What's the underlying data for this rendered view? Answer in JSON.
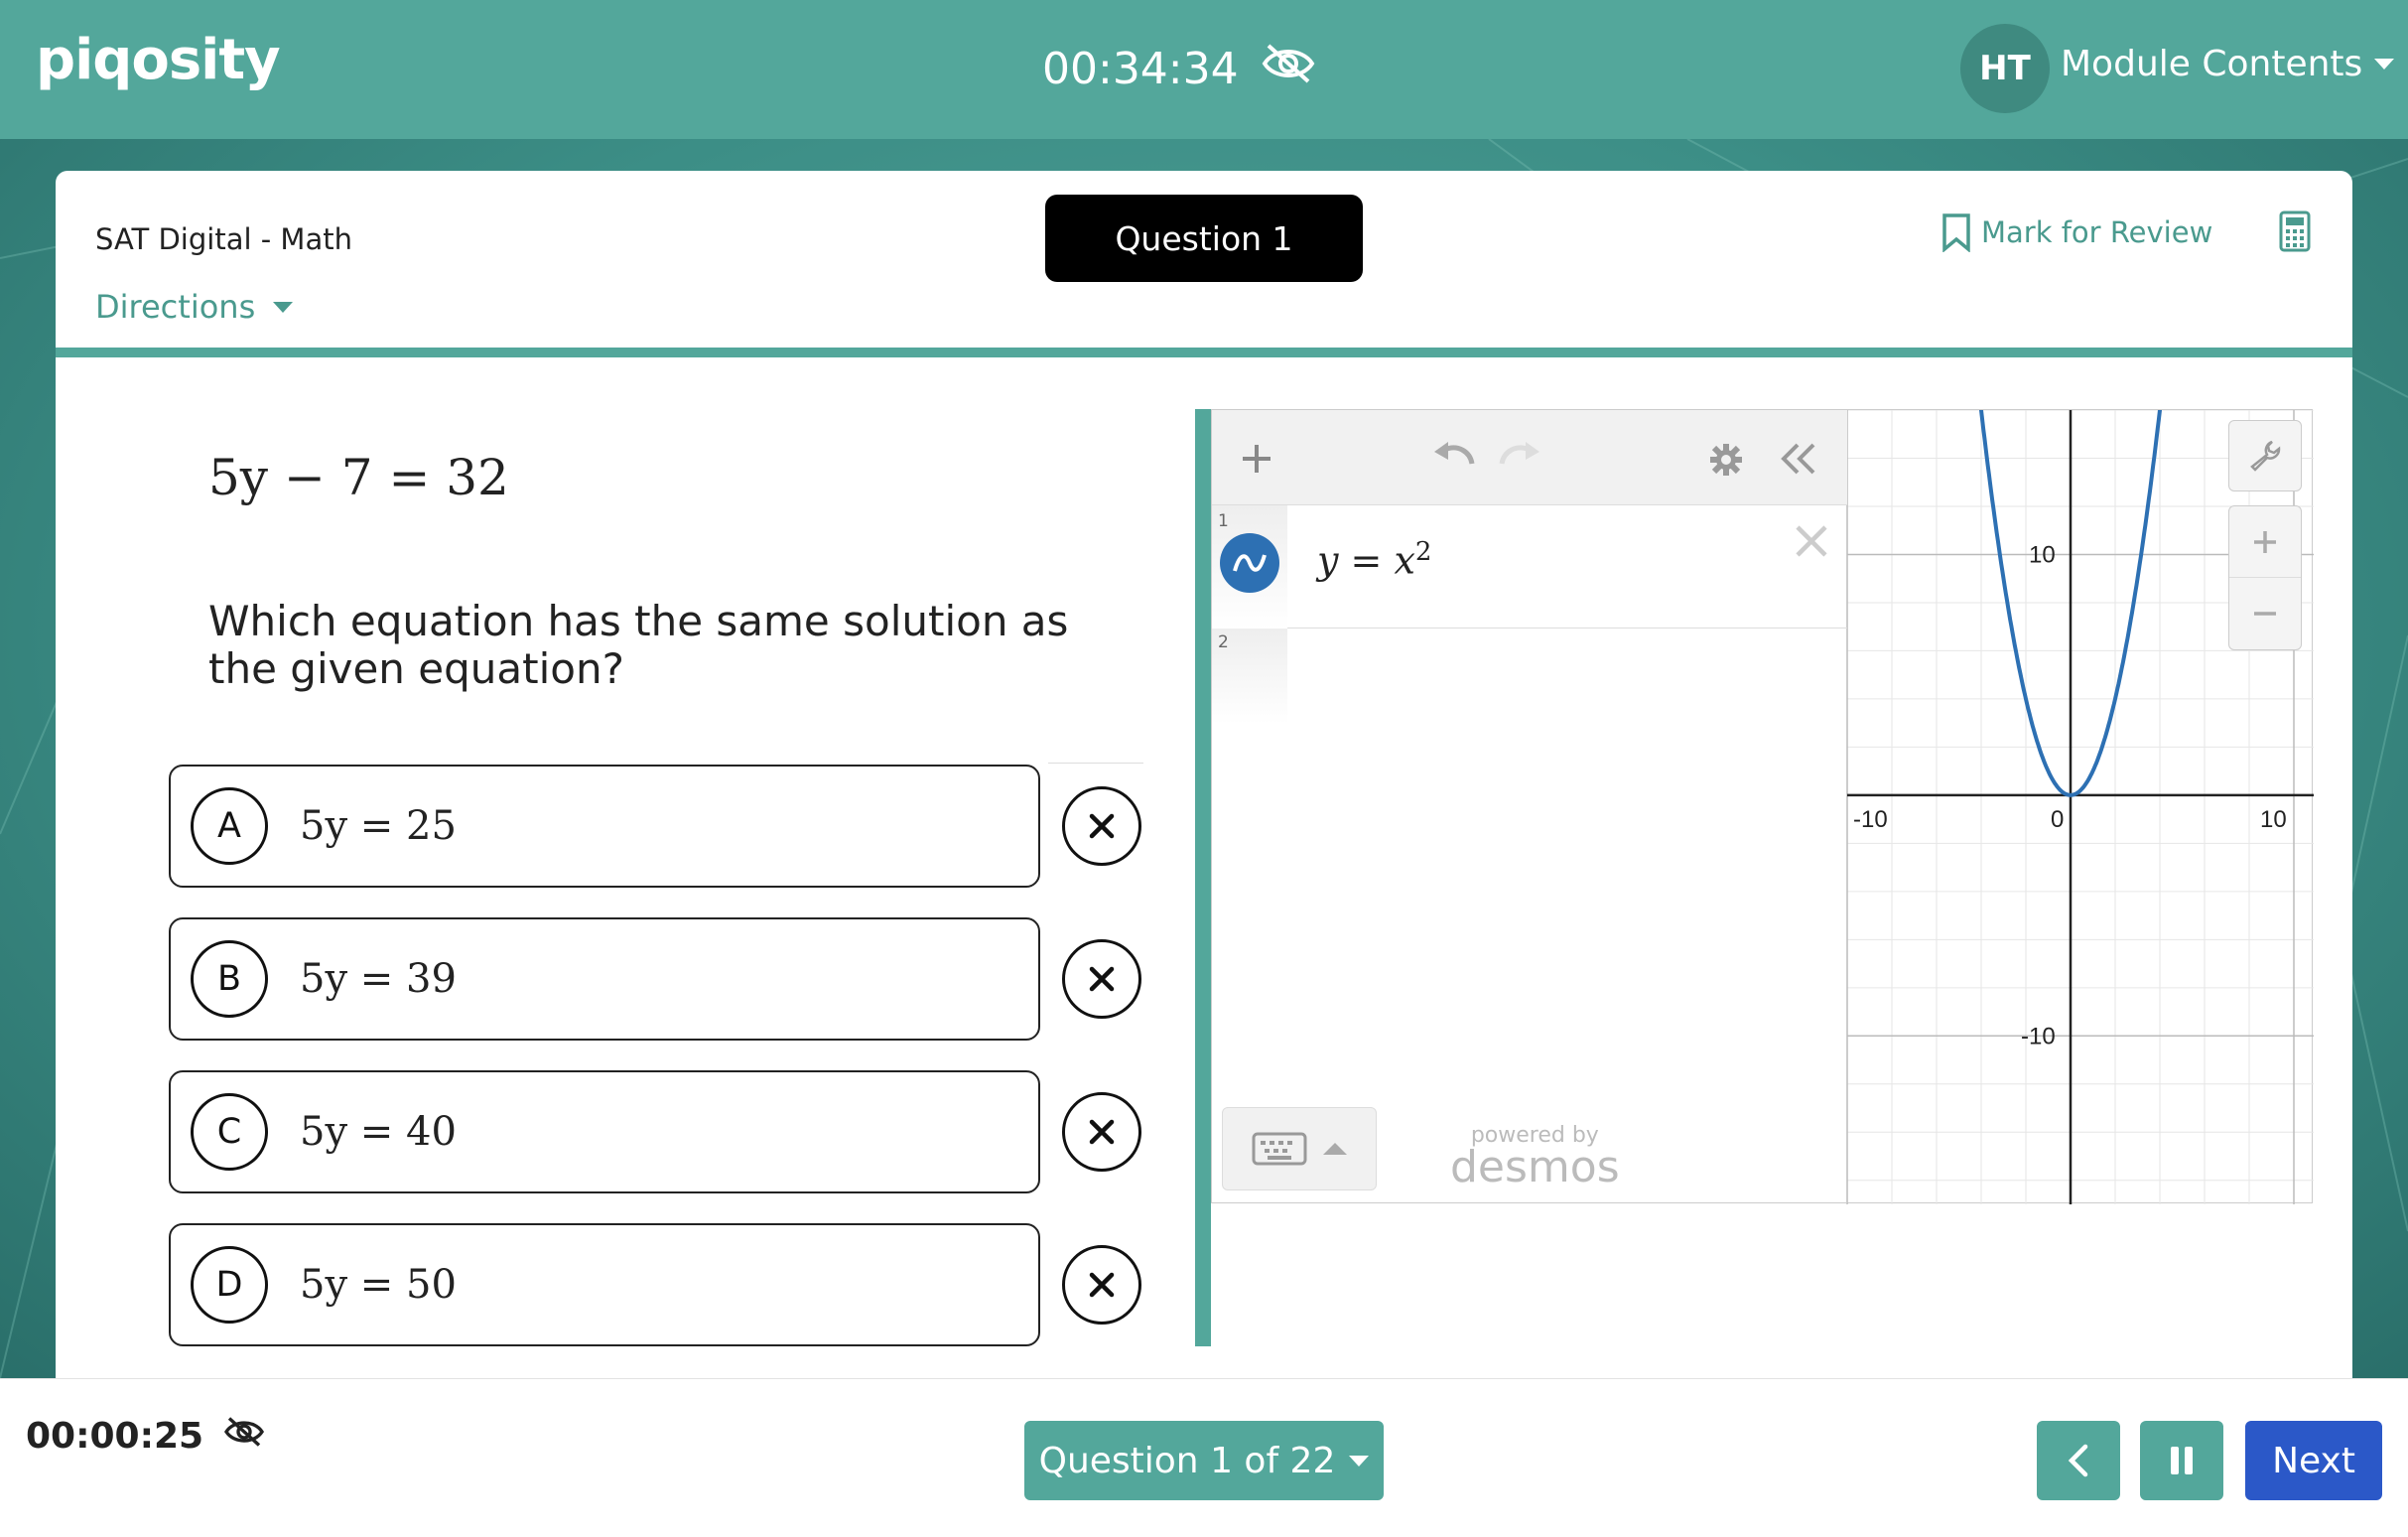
{
  "header": {
    "logo": "piqosity",
    "timer": "00:34:34",
    "avatar_initials": "HT",
    "module_menu": "Module Contents"
  },
  "card": {
    "subject": "SAT Digital - Math",
    "directions": "Directions",
    "question_badge": "Question 1",
    "mark_for_review": "Mark for Review"
  },
  "question": {
    "equation": "5y − 7 = 32",
    "prompt": "Which equation has the same solution as the given equation?",
    "choices": [
      {
        "letter": "A",
        "text": "5y = 25"
      },
      {
        "letter": "B",
        "text": "5y = 39"
      },
      {
        "letter": "C",
        "text": "5y = 40"
      },
      {
        "letter": "D",
        "text": "5y = 50"
      }
    ]
  },
  "calculator": {
    "expressions": [
      {
        "index": "1",
        "latex_display": "y = x",
        "exponent": "2"
      },
      {
        "index": "2",
        "latex_display": ""
      }
    ],
    "powered_by": "powered by",
    "brand": "desmos",
    "axis_labels": {
      "x_min": "-10",
      "x_zero": "0",
      "x_max": "10",
      "y_max": "10",
      "y_min": "-10"
    },
    "plot": {
      "function": "y = x^2",
      "x_range": [
        -10,
        10
      ],
      "y_range": [
        -17,
        16
      ],
      "curve_color": "#2d70b3"
    }
  },
  "footer": {
    "timer": "00:00:25",
    "question_nav": "Question 1 of 22",
    "next": "Next"
  },
  "colors": {
    "accent": "#53a79b",
    "primary_button": "#2b58c8"
  }
}
